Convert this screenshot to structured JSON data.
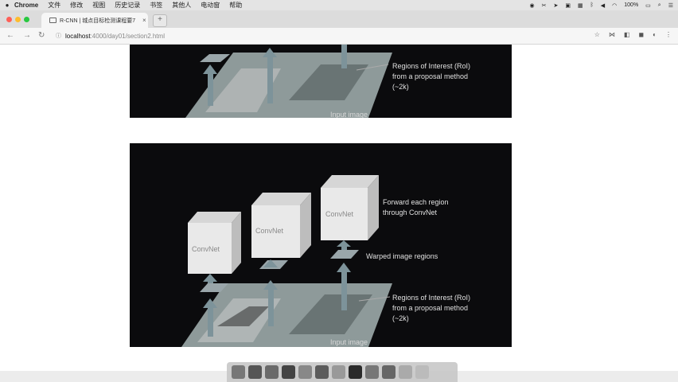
{
  "menubar": {
    "app": "Chrome",
    "items": [
      "文件",
      "修改",
      "视图",
      "历史记录",
      "书签",
      "其他人",
      "电动窗",
      "帮助"
    ],
    "battery": "100%"
  },
  "tab": {
    "title": "R-CNN | 城点目标检测课程要7",
    "close": "×"
  },
  "newtab": "+",
  "address": {
    "host": "localhost",
    "path": ":4000/day01/section2.html"
  },
  "slide_top": {
    "roi_label": [
      "Regions of Interest (RoI)",
      "from a proposal method",
      "(~2k)"
    ],
    "input_label": "Input image"
  },
  "slide_bottom": {
    "convnet": [
      "ConvNet",
      "ConvNet",
      "ConvNet"
    ],
    "forward_label": [
      "Forward each region",
      "through ConvNet"
    ],
    "warped_label": "Warped image regions",
    "roi_label": [
      "Regions of Interest (RoI)",
      "from a proposal method",
      "(~2k)"
    ],
    "input_label": "Input image"
  },
  "colors": {
    "slide_bg": "#0b0b0d",
    "arrow": "#7d939a",
    "cube_front": "#e9e9e9",
    "cube_side": "#bdbdbd",
    "cube_top": "#d6d6d6"
  }
}
